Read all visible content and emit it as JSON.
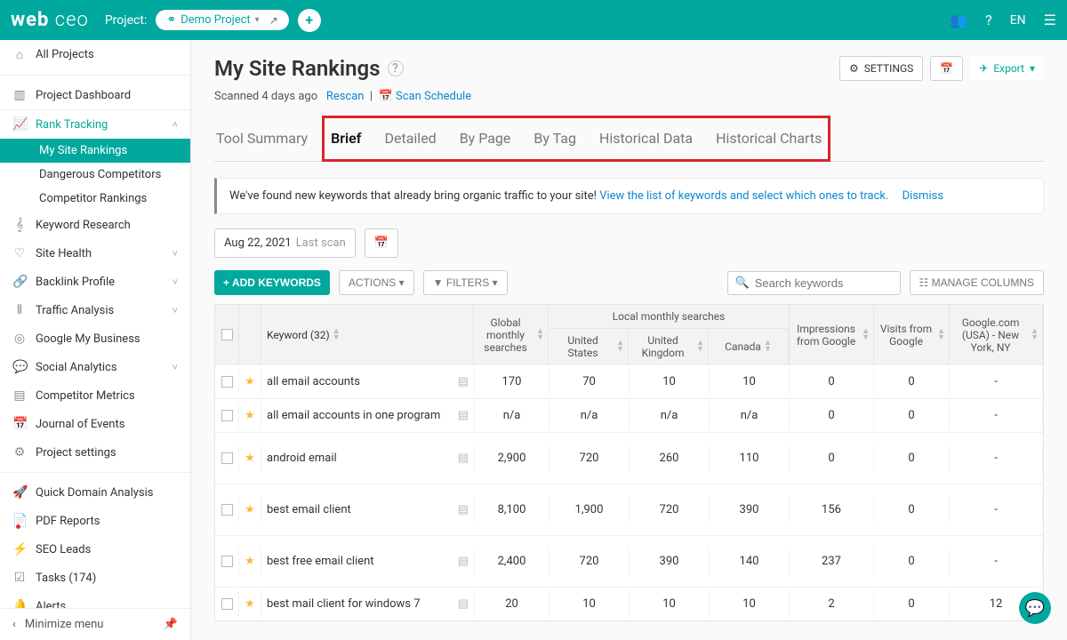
{
  "header": {
    "project_label": "Project:",
    "project_name": "Demo Project",
    "lang": "EN"
  },
  "sidebar": {
    "all_projects": "All Projects",
    "project_dashboard": "Project Dashboard",
    "rank_tracking": "Rank Tracking",
    "my_site_rankings": "My Site Rankings",
    "dangerous_competitors": "Dangerous Competitors",
    "competitor_rankings": "Competitor Rankings",
    "keyword_research": "Keyword Research",
    "site_health": "Site Health",
    "backlink_profile": "Backlink Profile",
    "traffic_analysis": "Traffic Analysis",
    "google_my_business": "Google My Business",
    "social_analytics": "Social Analytics",
    "competitor_metrics": "Competitor Metrics",
    "journal": "Journal of Events",
    "project_settings": "Project settings",
    "quick_domain": "Quick Domain Analysis",
    "pdf_reports": "PDF Reports",
    "seo_leads": "SEO Leads",
    "tasks": "Tasks (174)",
    "alerts": "Alerts",
    "minimize": "Minimize menu"
  },
  "page": {
    "title": "My Site Rankings",
    "settings_btn": "SETTINGS",
    "export_btn": "Export",
    "scanned": "Scanned 4 days ago",
    "rescan": "Rescan",
    "scan_schedule": "Scan Schedule"
  },
  "tabs": {
    "tool_summary": "Tool Summary",
    "brief": "Brief",
    "detailed": "Detailed",
    "by_page": "By Page",
    "by_tag": "By Tag",
    "historical_data": "Historical Data",
    "historical_charts": "Historical Charts"
  },
  "notice": {
    "text": "We've found new keywords that already bring organic traffic to your site! ",
    "link": "View the list of keywords and select which ones to track.",
    "dismiss": "Dismiss"
  },
  "date": {
    "value": "Aug 22, 2021",
    "label": "Last scan"
  },
  "toolbar": {
    "add_keywords": "+ ADD KEYWORDS",
    "actions": "ACTIONS",
    "filters": "FILTERS",
    "search_placeholder": "Search keywords",
    "manage_columns": "MANAGE COLUMNS"
  },
  "table": {
    "headers": {
      "keyword": "Keyword (32)",
      "gms": "Global monthly searches",
      "local": "Local monthly searches",
      "us": "United States",
      "uk": "United Kingdom",
      "ca": "Canada",
      "imp": "Impressions from Google",
      "vis": "Visits from Google",
      "gc": "Google.com (USA) - New York, NY"
    },
    "rows": [
      {
        "kw": "all email accounts",
        "gms": "170",
        "us": "70",
        "uk": "10",
        "ca": "10",
        "imp": "0",
        "vis": "0",
        "gc": "-"
      },
      {
        "kw": "all email accounts in one program",
        "gms": "n/a",
        "us": "n/a",
        "uk": "n/a",
        "ca": "n/a",
        "imp": "0",
        "vis": "0",
        "gc": "-"
      },
      {
        "kw": "android email",
        "gms": "2,900",
        "us": "720",
        "uk": "260",
        "ca": "110",
        "imp": "0",
        "vis": "0",
        "gc": "-"
      },
      {
        "kw": "best email client",
        "gms": "8,100",
        "us": "1,900",
        "uk": "720",
        "ca": "390",
        "imp": "156",
        "vis": "0",
        "gc": "-"
      },
      {
        "kw": "best free email client",
        "gms": "2,400",
        "us": "720",
        "uk": "390",
        "ca": "140",
        "imp": "237",
        "vis": "0",
        "gc": "-"
      },
      {
        "kw": "best mail client for windows 7",
        "gms": "20",
        "us": "10",
        "uk": "10",
        "ca": "10",
        "imp": "2",
        "vis": "0",
        "gc": "12"
      }
    ]
  }
}
